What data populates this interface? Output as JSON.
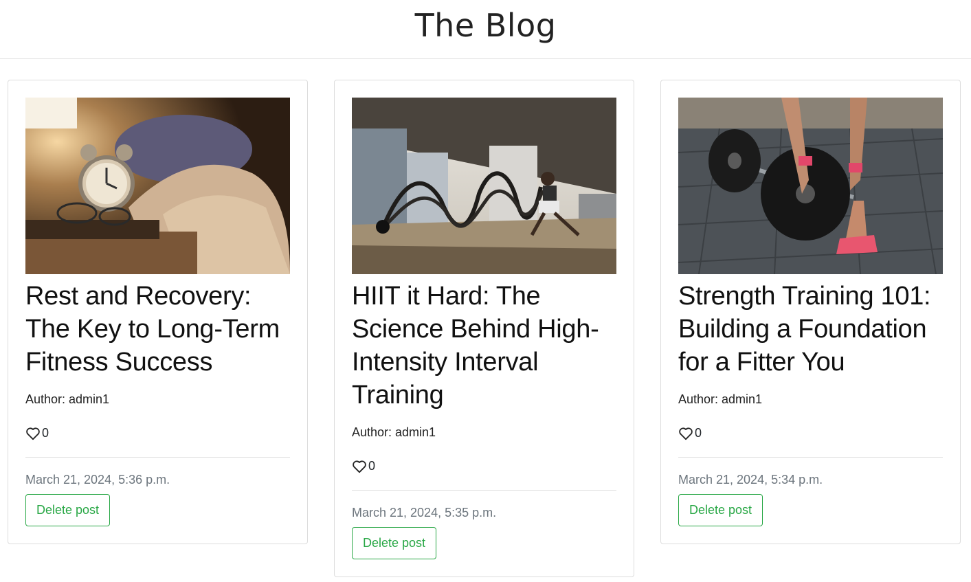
{
  "header": {
    "title": "The Blog"
  },
  "posts": [
    {
      "title": "Rest and Recovery: The Key to Long-Term Fitness Success",
      "author_label": "Author: admin1",
      "likes": "0",
      "date": "March 21, 2024, 5:36 p.m.",
      "delete_label": "Delete post"
    },
    {
      "title": "HIIT it Hard: The Science Behind High-Intensity Interval Training",
      "author_label": "Author: admin1",
      "likes": "0",
      "date": "March 21, 2024, 5:35 p.m.",
      "delete_label": "Delete post"
    },
    {
      "title": "Strength Training 101: Building a Foundation for a Fitter You",
      "author_label": "Author: admin1",
      "likes": "0",
      "date": "March 21, 2024, 5:34 p.m.",
      "delete_label": "Delete post"
    }
  ],
  "icons": {
    "like": "heart-outline-icon"
  },
  "colors": {
    "accent": "#28a745",
    "muted": "#6c757d",
    "border": "#dcdcdc"
  }
}
